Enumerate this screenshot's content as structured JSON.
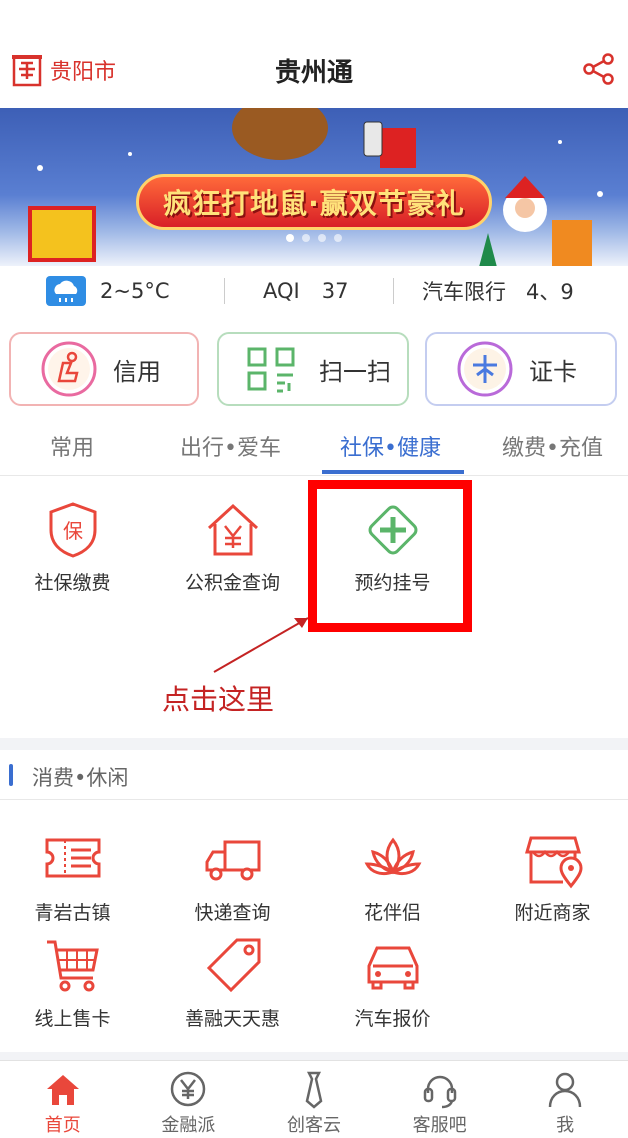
{
  "header": {
    "city": "贵阳市",
    "title": "贵州通"
  },
  "banner": {
    "text": "疯狂打地鼠·赢双节豪礼",
    "slides": 4,
    "active_slide": 1
  },
  "info": {
    "temperature": "2~5°C",
    "aqi_label": "AQI",
    "aqi_value": "37",
    "limit_label": "汽车限行",
    "limit_value": "4、9"
  },
  "quick_actions": [
    {
      "label": "信用",
      "icon": "credit-icon"
    },
    {
      "label": "扫一扫",
      "icon": "qr-scan-icon"
    },
    {
      "label": "证卡",
      "icon": "card-icon"
    }
  ],
  "tabs": [
    {
      "label": "常用",
      "active": false
    },
    {
      "label": "出行•爱车",
      "active": false
    },
    {
      "label": "社保•健康",
      "active": true
    },
    {
      "label": "缴费•充值",
      "active": false
    }
  ],
  "services": [
    {
      "label": "社保缴费",
      "icon": "shield-icon"
    },
    {
      "label": "公积金查询",
      "icon": "house-yen-icon"
    },
    {
      "label": "预约挂号",
      "icon": "medical-cross-icon"
    }
  ],
  "annotation": {
    "text": "点击这里"
  },
  "section": {
    "title": "消费•休闲"
  },
  "leisure": [
    {
      "label": "青岩古镇",
      "icon": "ticket-icon"
    },
    {
      "label": "快递查询",
      "icon": "truck-icon"
    },
    {
      "label": "花伴侣",
      "icon": "lotus-icon"
    },
    {
      "label": "附近商家",
      "icon": "store-location-icon"
    },
    {
      "label": "线上售卡",
      "icon": "cart-icon"
    },
    {
      "label": "善融天天惠",
      "icon": "tag-icon"
    },
    {
      "label": "汽车报价",
      "icon": "car-icon"
    }
  ],
  "nav": [
    {
      "label": "首页",
      "icon": "home-icon",
      "active": true
    },
    {
      "label": "金融派",
      "icon": "yen-icon",
      "active": false
    },
    {
      "label": "创客云",
      "icon": "tie-icon",
      "active": false
    },
    {
      "label": "客服吧",
      "icon": "headset-icon",
      "active": false
    },
    {
      "label": "我",
      "icon": "user-icon",
      "active": false
    }
  ],
  "colors": {
    "brand_red": "#d8322c",
    "accent_blue": "#3a6ed0",
    "highlight_red": "#ff0000",
    "annotation_red": "#c42323",
    "nav_active": "#e9473b"
  }
}
